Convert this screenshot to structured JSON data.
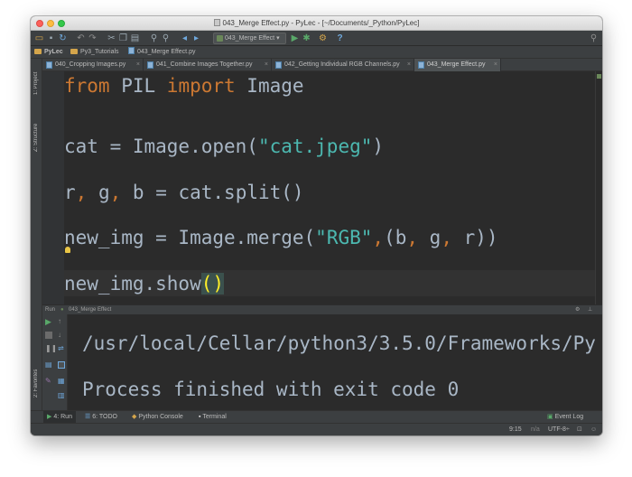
{
  "window": {
    "title": "043_Merge Effect.py - PyLec - [~/Documents/_Python/PyLec]"
  },
  "toolbar": {
    "run_config": "043_Merge Effect",
    "icons": [
      "folder-open-icon",
      "save-icon",
      "sync-icon",
      "undo-icon",
      "redo-icon",
      "cut-icon",
      "copy-icon",
      "paste-icon",
      "find-icon",
      "replace-icon",
      "back-icon",
      "forward-icon",
      "run-icon",
      "debug-icon",
      "vcs-icon",
      "help-icon",
      "search-icon"
    ]
  },
  "navbar": {
    "crumbs": [
      "PyLec",
      "Py3_Tutorials",
      "043_Merge Effect.py"
    ]
  },
  "tabs": [
    {
      "label": "040_Cropping Images.py",
      "active": false
    },
    {
      "label": "041_Combine Images Together.py",
      "active": false
    },
    {
      "label": "042_Getting Individual RGB Channels.py",
      "active": false
    },
    {
      "label": "043_Merge Effect.py",
      "active": true
    }
  ],
  "left_strip": {
    "project": "1: Project",
    "structure": "Z: Structure",
    "favorites": "2: Favorites"
  },
  "code": {
    "line1": {
      "kw1": "from",
      "mod": " PIL ",
      "kw2": "import",
      "name": " Image"
    },
    "line2": {
      "a": "cat = Image.open(",
      "q1": "\"",
      "s": "cat.jpeg",
      "q2": "\"",
      "b": ")"
    },
    "line3": {
      "a": "r",
      "c1": ",",
      "b": " g",
      "c2": ",",
      "c": " b = cat.split()"
    },
    "line4": {
      "a": "new_img = Image.merge(",
      "q1": "\"",
      "s": "RGB",
      "q2": "\"",
      "c1": ",",
      "b": "(b",
      "c2": ",",
      "c": " g",
      "c3": ",",
      "d": " r))"
    },
    "line5": {
      "a": "new_img.show",
      "br": "()"
    }
  },
  "run_panel": {
    "header_prefix": "Run",
    "header_config": "043_Merge Effect",
    "output_line1": "/usr/local/Cellar/python3/3.5.0/Frameworks/Py",
    "output_line2": "Process finished with exit code 0"
  },
  "bottom_tabs": [
    {
      "label": "4: Run",
      "active": true
    },
    {
      "label": "6: TODO",
      "active": false
    },
    {
      "label": "Python Console",
      "active": false
    },
    {
      "label": "Terminal",
      "active": false
    }
  ],
  "event_log": "Event Log",
  "status": {
    "position": "9:15",
    "na": "n/a",
    "encoding": "UTF-8÷"
  },
  "colors": {
    "keyword": "#cc7832",
    "string": "#6a8759",
    "string_cyan": "#4cb8b0",
    "text": "#a9b7c6",
    "editor_bg": "#2b2b2b",
    "chrome_bg": "#3c3f41"
  }
}
